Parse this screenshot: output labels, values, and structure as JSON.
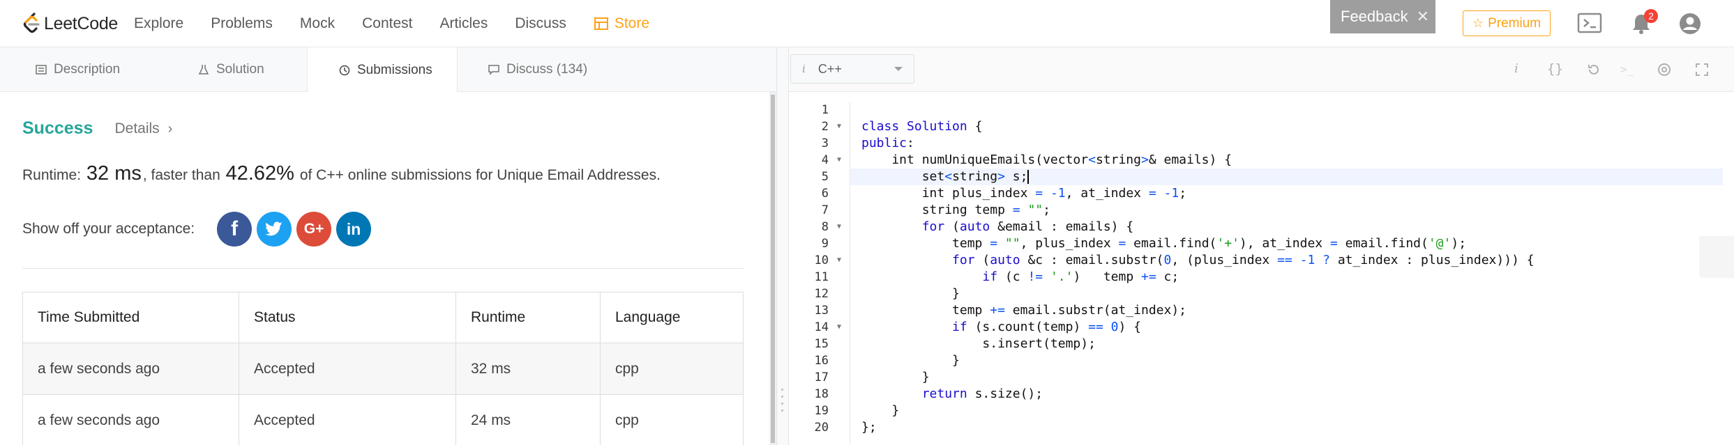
{
  "nav": {
    "logo_text": "LeetCode",
    "links": [
      "Explore",
      "Problems",
      "Mock",
      "Contest",
      "Articles",
      "Discuss"
    ],
    "store": "Store",
    "feedback": "Feedback",
    "feedback_close": "✕",
    "premium": "Premium",
    "notification_count": "2"
  },
  "tabs": {
    "description": "Description",
    "solution": "Solution",
    "submissions": "Submissions",
    "discuss": "Discuss (134)"
  },
  "result": {
    "status": "Success",
    "details": "Details",
    "runtime_prefix": "Runtime:",
    "runtime_value": "32 ms",
    "faster_text": ", faster than",
    "percent": "42.62%",
    "suffix": "of C++ online submissions for Unique Email Addresses."
  },
  "share": {
    "label": "Show off your acceptance:",
    "icons": [
      "facebook-icon",
      "twitter-icon",
      "google-plus-icon",
      "linkedin-icon"
    ]
  },
  "table": {
    "headers": [
      "Time Submitted",
      "Status",
      "Runtime",
      "Language"
    ],
    "rows": [
      [
        "a few seconds ago",
        "Accepted",
        "32 ms",
        "cpp"
      ],
      [
        "a few seconds ago",
        "Accepted",
        "24 ms",
        "cpp"
      ]
    ]
  },
  "editor": {
    "language": "C++",
    "line_numbers": [
      "1",
      "2",
      "3",
      "4",
      "5",
      "6",
      "7",
      "8",
      "9",
      "10",
      "11",
      "12",
      "13",
      "14",
      "15",
      "16",
      "17",
      "18",
      "19",
      "20"
    ]
  },
  "colors": {
    "accent_green": "#26a69a",
    "store_orange": "#fea116",
    "badge_red": "#f44336"
  }
}
